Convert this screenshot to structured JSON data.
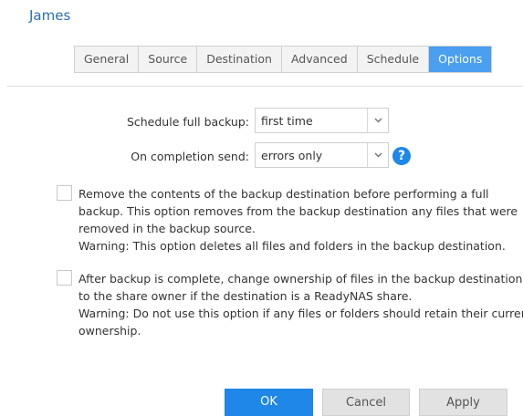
{
  "header": {
    "title": "James"
  },
  "tabs": [
    {
      "label": "General"
    },
    {
      "label": "Source"
    },
    {
      "label": "Destination"
    },
    {
      "label": "Advanced"
    },
    {
      "label": "Schedule"
    },
    {
      "label": "Options",
      "active": true
    }
  ],
  "form": {
    "full_backup": {
      "label": "Schedule full backup:",
      "value": "first time"
    },
    "completion": {
      "label": "On completion send:",
      "value": "errors only"
    },
    "help_glyph": "?"
  },
  "options": [
    {
      "checked": false,
      "lines": [
        "Remove the contents of the backup destination before performing a full",
        "backup. This option removes from the backup destination any files that were",
        "removed in the backup source.",
        "Warning: This option deletes all files and folders in the backup destination."
      ]
    },
    {
      "checked": false,
      "lines": [
        "After backup is complete, change ownership of files in the backup destination",
        "to the share owner if the destination is a ReadyNAS share.",
        "Warning: Do not use this option if any files or folders should retain their current",
        "ownership."
      ]
    }
  ],
  "buttons": {
    "ok": "OK",
    "cancel": "Cancel",
    "apply": "Apply"
  },
  "colors": {
    "accent": "#1e87e8",
    "title": "#2a6fb0",
    "tab_active": "#4a9ff0"
  }
}
